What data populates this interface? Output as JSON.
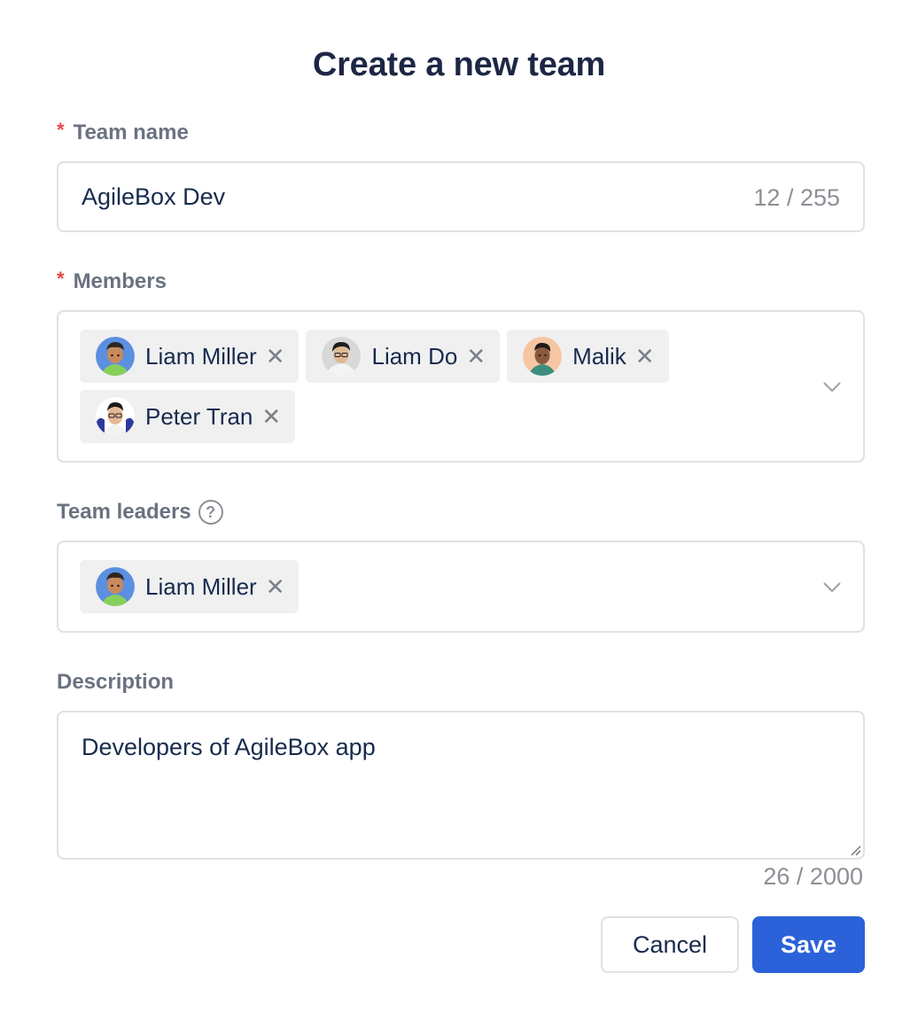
{
  "modal": {
    "title": "Create a new team"
  },
  "team_name": {
    "label": "Team name",
    "required_mark": "*",
    "value": "AgileBox Dev",
    "counter": "12 / 255"
  },
  "members": {
    "label": "Members",
    "required_mark": "*",
    "chips": [
      {
        "name": "Liam Miller",
        "avatar": "avatar-liam-miller"
      },
      {
        "name": "Liam Do",
        "avatar": "avatar-liam-do"
      },
      {
        "name": "Malik",
        "avatar": "avatar-malik"
      },
      {
        "name": "Peter Tran",
        "avatar": "avatar-peter-tran"
      }
    ],
    "remove_glyph": "✕"
  },
  "team_leaders": {
    "label": "Team leaders",
    "help_glyph": "?",
    "chips": [
      {
        "name": "Liam Miller",
        "avatar": "avatar-liam-miller"
      }
    ]
  },
  "description": {
    "label": "Description",
    "value": "Developers of AgileBox app",
    "counter": "26 / 2000"
  },
  "actions": {
    "cancel": "Cancel",
    "save": "Save"
  },
  "colors": {
    "primary": "#2b62d9",
    "required": "#e5484d",
    "chip_bg": "#f0f0f1"
  },
  "icons": [
    "chevron-down-icon",
    "close-icon",
    "help-circle-icon",
    "resize-handle-icon"
  ]
}
